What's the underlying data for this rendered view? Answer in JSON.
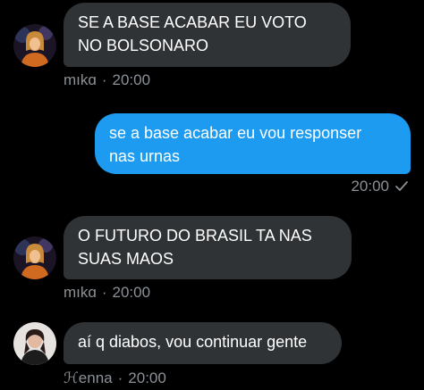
{
  "colors": {
    "background": "#000000",
    "incoming_bubble": "#2f3336",
    "outgoing_bubble": "#1d9bf0",
    "meta_text": "#8b9196"
  },
  "messages": [
    {
      "direction": "incoming",
      "text": "SE A BASE ACABAR EU VOTO\nNO BOLSONARO",
      "sender": "mıkɑ",
      "time": "20:00",
      "avatar": "avatar-mika"
    },
    {
      "direction": "outgoing",
      "text": "se a base acabar eu vou responser\nnas urnas",
      "time": "20:00",
      "status_icon": "check-icon"
    },
    {
      "direction": "incoming",
      "text": "O FUTURO DO BRASIL TA NAS\nSUAS MAOS",
      "sender": "mıkɑ",
      "time": "20:00",
      "avatar": "avatar-mika"
    },
    {
      "direction": "incoming",
      "text": "aí q diabos, vou continuar gente",
      "sender": "ℋenna",
      "time": "20:00",
      "avatar": "avatar-henna"
    }
  ],
  "separator": "·"
}
